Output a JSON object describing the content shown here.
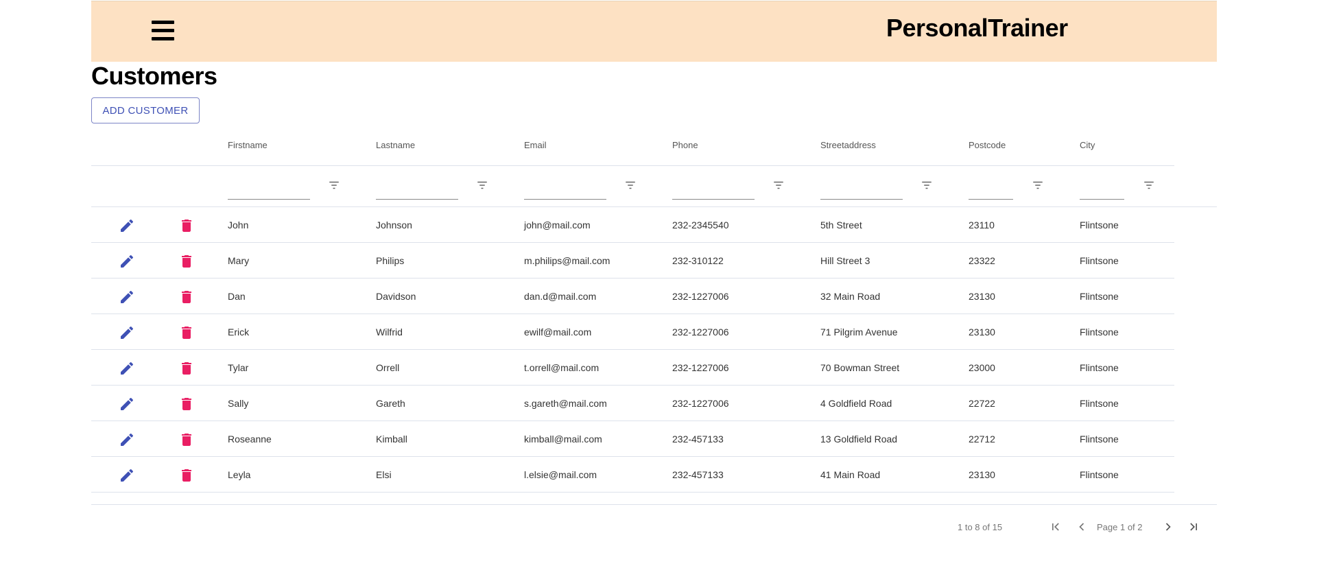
{
  "app": {
    "title": "PersonalTrainer"
  },
  "page": {
    "title": "Customers"
  },
  "toolbar": {
    "add_label": "ADD CUSTOMER"
  },
  "table": {
    "columns": [
      "Firstname",
      "Lastname",
      "Email",
      "Phone",
      "Streetaddress",
      "Postcode",
      "City"
    ],
    "rows": [
      [
        "John",
        "Johnson",
        "john@mail.com",
        "232-2345540",
        "5th Street",
        "23110",
        "Flintsone"
      ],
      [
        "Mary",
        "Philips",
        "m.philips@mail.com",
        "232-310122",
        "Hill Street 3",
        "23322",
        "Flintsone"
      ],
      [
        "Dan",
        "Davidson",
        "dan.d@mail.com",
        "232-1227006",
        "32 Main Road",
        "23130",
        "Flintsone"
      ],
      [
        "Erick",
        "Wilfrid",
        "ewilf@mail.com",
        "232-1227006",
        "71 Pilgrim Avenue",
        "23130",
        "Flintsone"
      ],
      [
        "Tylar",
        "Orrell",
        "t.orrell@mail.com",
        "232-1227006",
        "70 Bowman Street",
        "23000",
        "Flintsone"
      ],
      [
        "Sally",
        "Gareth",
        "s.gareth@mail.com",
        "232-1227006",
        "4 Goldfield Road",
        "22722",
        "Flintsone"
      ],
      [
        "Roseanne",
        "Kimball",
        "kimball@mail.com",
        "232-457133",
        "13 Goldfield Road",
        "22712",
        "Flintsone"
      ],
      [
        "Leyla",
        "Elsi",
        "l.elsie@mail.com",
        "232-457133",
        "41 Main Road",
        "23130",
        "Flintsone"
      ]
    ]
  },
  "pagination": {
    "range": "1 to 8 of 15",
    "page": "Page 1 of 2"
  },
  "icons": {
    "menu": "menu-icon",
    "edit": "edit-icon",
    "delete": "delete-icon",
    "filter": "filter-icon",
    "first": "first-page-icon",
    "prev": "prev-page-icon",
    "next": "next-page-icon",
    "last": "last-page-icon"
  },
  "colors": {
    "appbar": "#fde1c3",
    "edit": "#3f51b5",
    "delete": "#e91e63",
    "button_border": "#7c84c6"
  }
}
